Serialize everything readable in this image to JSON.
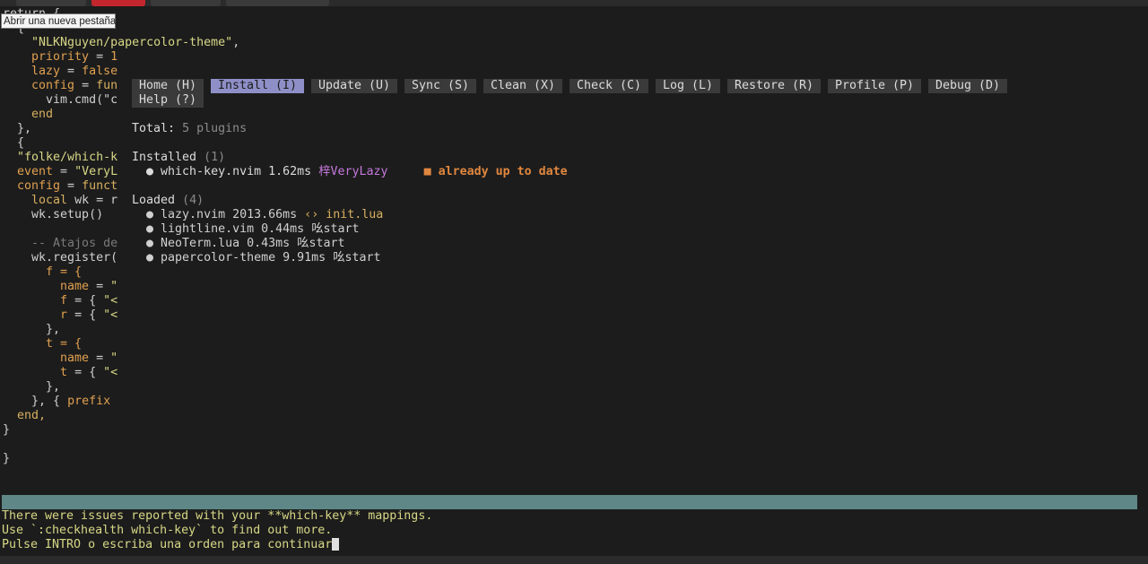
{
  "window": {
    "tooltip": "Abrir una nueva pestaña"
  },
  "tabs": [
    {
      "color": "#3a3a3a"
    },
    {
      "color": "#c4262e"
    },
    {
      "color": "#3a3a3a"
    },
    {
      "color": "#3a3a3a"
    }
  ],
  "editor": {
    "lines": [
      {
        "segments": [
          {
            "text": "return {",
            "color": "#d0d0d0"
          }
        ]
      },
      {
        "segments": [
          {
            "text": "  {",
            "color": "#d0d0d0"
          }
        ]
      },
      {
        "segments": [
          {
            "text": "    \"NLKNguyen/papercolor-theme\"",
            "color": "#d7d787"
          },
          {
            "text": ",",
            "color": "#d0d0d0"
          }
        ]
      },
      {
        "segments": [
          {
            "text": "    priority",
            "color": "#e0a050"
          },
          {
            "text": " = ",
            "color": "#d0d0d0"
          },
          {
            "text": "1",
            "color": "#e0a050"
          }
        ]
      },
      {
        "segments": [
          {
            "text": "    lazy",
            "color": "#e0a050"
          },
          {
            "text": " = ",
            "color": "#d0d0d0"
          },
          {
            "text": "false",
            "color": "#e0a050"
          }
        ]
      },
      {
        "segments": [
          {
            "text": "    config",
            "color": "#e0a050"
          },
          {
            "text": " = ",
            "color": "#d0d0d0"
          },
          {
            "text": "fun",
            "color": "#d7af5f"
          }
        ]
      },
      {
        "segments": [
          {
            "text": "      vim.cmd(\"c",
            "color": "#d0d0d0"
          }
        ]
      },
      {
        "segments": [
          {
            "text": "    end",
            "color": "#d7af5f"
          }
        ]
      },
      {
        "segments": [
          {
            "text": "  },",
            "color": "#d0d0d0"
          }
        ]
      },
      {
        "segments": [
          {
            "text": "  {",
            "color": "#d0d0d0"
          }
        ]
      },
      {
        "segments": [
          {
            "text": "  \"folke/which-k",
            "color": "#d7d787"
          }
        ]
      },
      {
        "segments": [
          {
            "text": "  event",
            "color": "#e0a050"
          },
          {
            "text": " = ",
            "color": "#d0d0d0"
          },
          {
            "text": "\"VeryL",
            "color": "#d7d787"
          }
        ]
      },
      {
        "segments": [
          {
            "text": "  config",
            "color": "#e0a050"
          },
          {
            "text": " = ",
            "color": "#d0d0d0"
          },
          {
            "text": "funct",
            "color": "#d7af5f"
          }
        ]
      },
      {
        "segments": [
          {
            "text": "    local",
            "color": "#d7af5f"
          },
          {
            "text": " wk = r",
            "color": "#d0d0d0"
          }
        ]
      },
      {
        "segments": [
          {
            "text": "    wk.setup()",
            "color": "#d0d0d0"
          }
        ]
      },
      {
        "segments": [
          {
            "text": "",
            "color": "#d0d0d0"
          }
        ]
      },
      {
        "segments": [
          {
            "text": "    -- Atajos de",
            "color": "#7a7a7a"
          }
        ]
      },
      {
        "segments": [
          {
            "text": "    wk.register(",
            "color": "#d0d0d0"
          }
        ]
      },
      {
        "segments": [
          {
            "text": "      f = {",
            "color": "#e0a050"
          }
        ]
      },
      {
        "segments": [
          {
            "text": "        name",
            "color": "#e0a050"
          },
          {
            "text": " = ",
            "color": "#d0d0d0"
          },
          {
            "text": "\"",
            "color": "#d7d787"
          }
        ]
      },
      {
        "segments": [
          {
            "text": "        f",
            "color": "#e0a050"
          },
          {
            "text": " = { ",
            "color": "#d0d0d0"
          },
          {
            "text": "\"<",
            "color": "#d7d787"
          }
        ]
      },
      {
        "segments": [
          {
            "text": "        r",
            "color": "#e0a050"
          },
          {
            "text": " = { ",
            "color": "#d0d0d0"
          },
          {
            "text": "\"<",
            "color": "#d7d787"
          }
        ]
      },
      {
        "segments": [
          {
            "text": "      },",
            "color": "#d0d0d0"
          }
        ]
      },
      {
        "segments": [
          {
            "text": "      t = {",
            "color": "#e0a050"
          }
        ]
      },
      {
        "segments": [
          {
            "text": "        name",
            "color": "#e0a050"
          },
          {
            "text": " = ",
            "color": "#d0d0d0"
          },
          {
            "text": "\"",
            "color": "#d7d787"
          }
        ]
      },
      {
        "segments": [
          {
            "text": "        t",
            "color": "#e0a050"
          },
          {
            "text": " = { ",
            "color": "#d0d0d0"
          },
          {
            "text": "\"<",
            "color": "#d7d787"
          }
        ]
      },
      {
        "segments": [
          {
            "text": "      },",
            "color": "#d0d0d0"
          }
        ]
      },
      {
        "segments": [
          {
            "text": "    }, { ",
            "color": "#d0d0d0"
          },
          {
            "text": "prefix",
            "color": "#e0a050"
          }
        ]
      },
      {
        "segments": [
          {
            "text": "  end,",
            "color": "#d7af5f"
          }
        ]
      },
      {
        "segments": [
          {
            "text": "}",
            "color": "#d0d0d0"
          }
        ]
      },
      {
        "segments": [
          {
            "text": "",
            "color": "#d0d0d0"
          }
        ]
      },
      {
        "segments": [
          {
            "text": "}",
            "color": "#d0d0d0"
          }
        ]
      }
    ]
  },
  "lazy": {
    "buttons": [
      {
        "label": "Home (H)",
        "active": false
      },
      {
        "label": "Install (I)",
        "active": true
      },
      {
        "label": "Update (U)",
        "active": false
      },
      {
        "label": "Sync (S)",
        "active": false
      },
      {
        "label": "Clean (X)",
        "active": false
      },
      {
        "label": "Check (C)",
        "active": false
      },
      {
        "label": "Log (L)",
        "active": false
      },
      {
        "label": "Restore (R)",
        "active": false
      },
      {
        "label": "Profile (P)",
        "active": false
      },
      {
        "label": "Debug (D)",
        "active": false
      },
      {
        "label": "Help (?)",
        "active": false
      }
    ],
    "total_label": "Total:",
    "total_value": "5 plugins",
    "installed": {
      "title": "Installed",
      "count": "(1)",
      "items": [
        {
          "name": "which-key.nvim",
          "time": "1.62ms",
          "icon": "梓",
          "source": "VeryLazy",
          "status_icon": "■",
          "status": "already up to date"
        }
      ]
    },
    "loaded": {
      "title": "Loaded",
      "count": "(4)",
      "items": [
        {
          "name": "lazy.nvim",
          "time": "2013.66ms",
          "icon": "",
          "source": "init.lua"
        },
        {
          "name": "lightline.vim",
          "time": "0.44ms",
          "icon": "吆",
          "source": "start"
        },
        {
          "name": "NeoTerm.lua",
          "time": "0.43ms",
          "icon": "吆",
          "source": "start"
        },
        {
          "name": "papercolor-theme",
          "time": "9.91ms",
          "icon": "吆",
          "source": "start"
        }
      ]
    }
  },
  "messages": {
    "line1": "There were issues reported with your **which-key** mappings.",
    "line2": "Use `:checkhealth which-key` to find out more.",
    "prompt": "Pulse INTRO o escriba una orden para continuar"
  },
  "colors": {
    "background": "#1c1c1c",
    "statusbar": "#5f8787",
    "active_button": "#8f8fc8",
    "warning": "#e0873f",
    "message": "#d7d787"
  }
}
